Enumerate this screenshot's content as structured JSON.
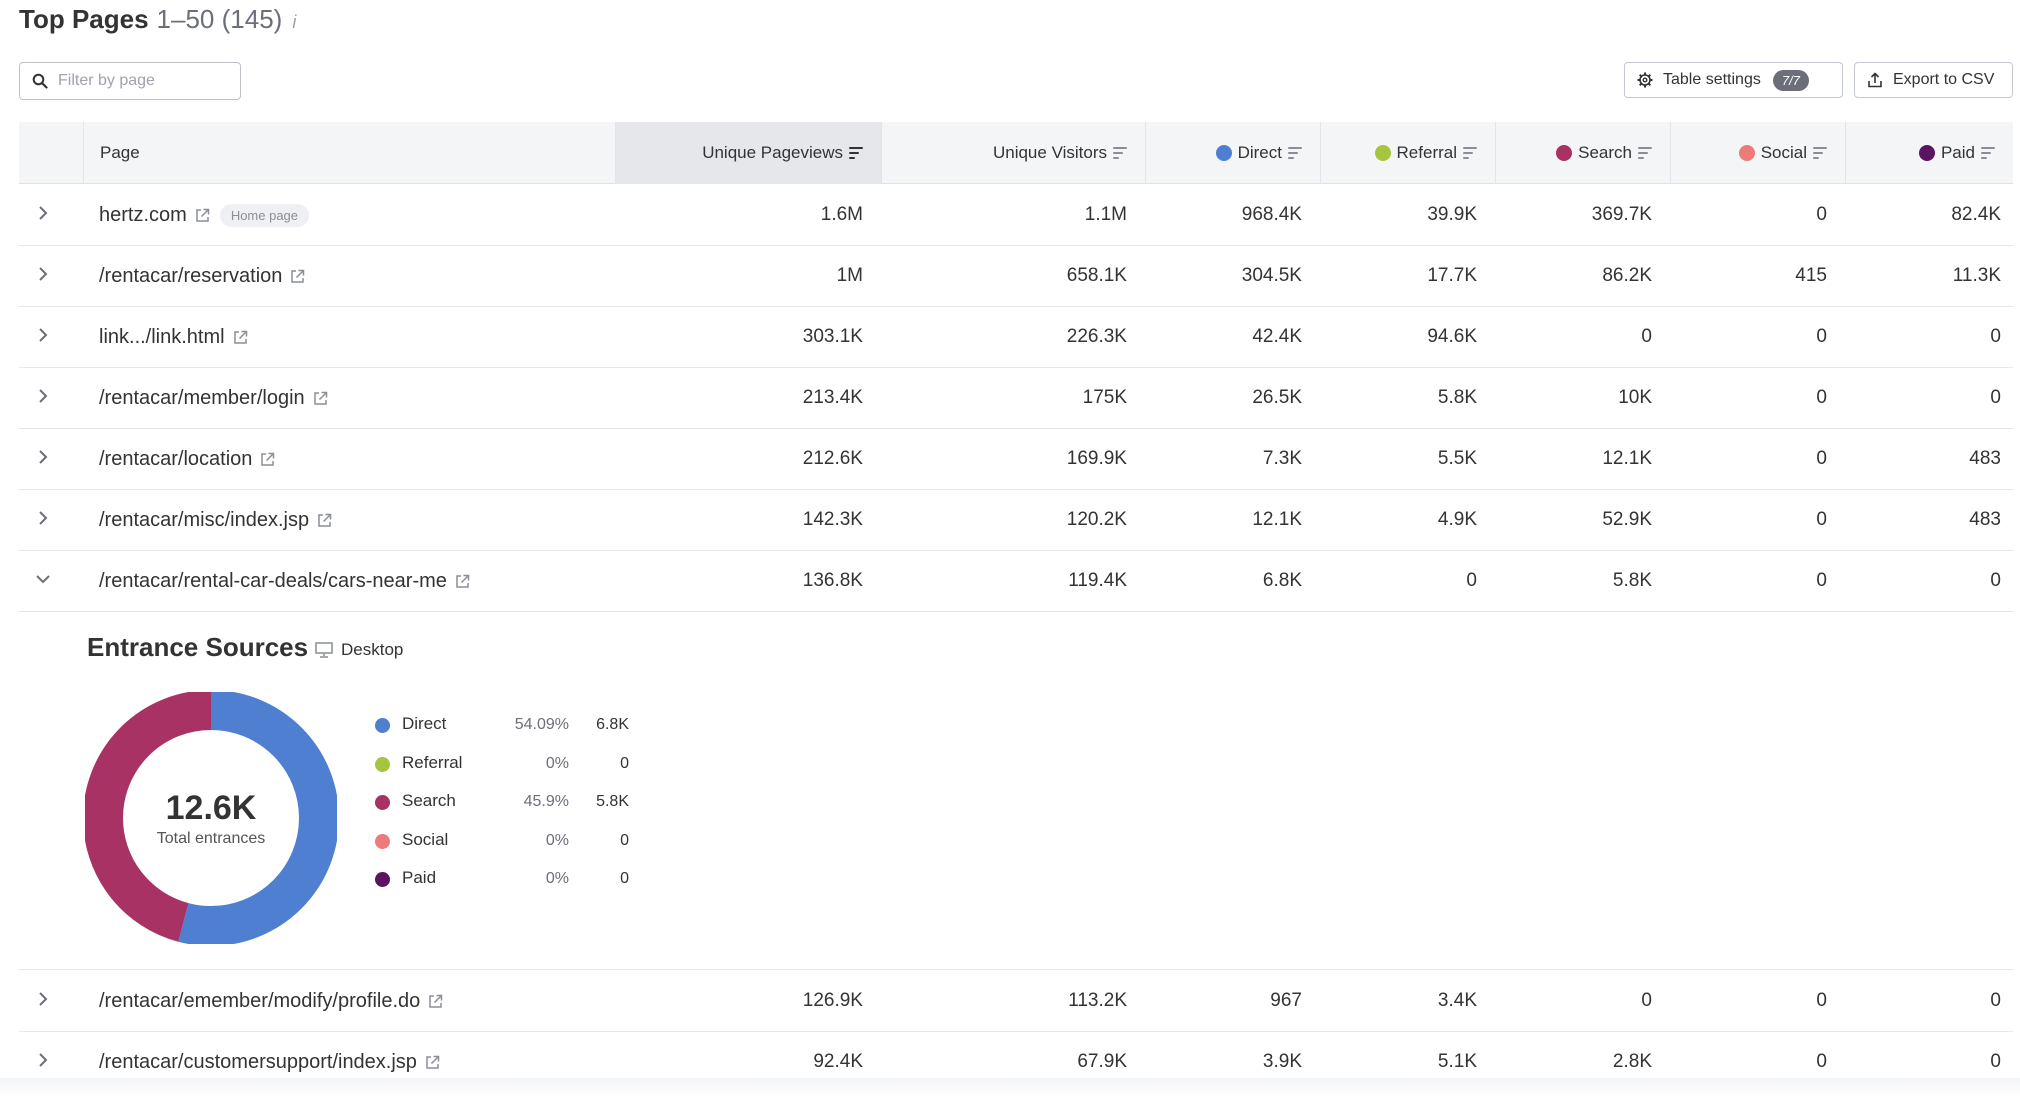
{
  "header": {
    "title": "Top Pages",
    "range": "1–50 (145)",
    "info": "i"
  },
  "filter": {
    "placeholder": "Filter by page",
    "value": ""
  },
  "toolbar": {
    "settings_label": "Table settings",
    "settings_badge": "7/7",
    "export_label": "Export to CSV"
  },
  "columns": {
    "page": "Page",
    "pageviews": "Unique Pageviews",
    "visitors": "Unique Visitors",
    "direct": "Direct",
    "referral": "Referral",
    "search": "Search",
    "social": "Social",
    "paid": "Paid"
  },
  "colors": {
    "direct": "#4f7fd0",
    "referral": "#a6c53e",
    "search": "#a83264",
    "social": "#ee7a7a",
    "paid": "#5a1462"
  },
  "rows": [
    {
      "page": "hertz.com",
      "badge": "Home page",
      "pageviews": "1.6M",
      "visitors": "1.1M",
      "direct": "968.4K",
      "referral": "39.9K",
      "search": "369.7K",
      "social": "0",
      "paid": "82.4K"
    },
    {
      "page": "/rentacar/reservation",
      "pageviews": "1M",
      "visitors": "658.1K",
      "direct": "304.5K",
      "referral": "17.7K",
      "search": "86.2K",
      "social": "415",
      "paid": "11.3K"
    },
    {
      "page": "link.../link.html",
      "pageviews": "303.1K",
      "visitors": "226.3K",
      "direct": "42.4K",
      "referral": "94.6K",
      "search": "0",
      "social": "0",
      "paid": "0"
    },
    {
      "page": "/rentacar/member/login",
      "pageviews": "213.4K",
      "visitors": "175K",
      "direct": "26.5K",
      "referral": "5.8K",
      "search": "10K",
      "social": "0",
      "paid": "0"
    },
    {
      "page": "/rentacar/location",
      "pageviews": "212.6K",
      "visitors": "169.9K",
      "direct": "7.3K",
      "referral": "5.5K",
      "search": "12.1K",
      "social": "0",
      "paid": "483"
    },
    {
      "page": "/rentacar/misc/index.jsp",
      "pageviews": "142.3K",
      "visitors": "120.2K",
      "direct": "12.1K",
      "referral": "4.9K",
      "search": "52.9K",
      "social": "0",
      "paid": "483"
    },
    {
      "page": "/rentacar/rental-car-deals/cars-near-me",
      "pageviews": "136.8K",
      "visitors": "119.4K",
      "direct": "6.8K",
      "referral": "0",
      "search": "5.8K",
      "social": "0",
      "paid": "0"
    },
    {
      "page": "/rentacar/emember/modify/profile.do",
      "pageviews": "126.9K",
      "visitors": "113.2K",
      "direct": "967",
      "referral": "3.4K",
      "search": "0",
      "social": "0",
      "paid": "0"
    },
    {
      "page": "/rentacar/customersupport/index.jsp",
      "pageviews": "92.4K",
      "visitors": "67.9K",
      "direct": "3.9K",
      "referral": "5.1K",
      "search": "2.8K",
      "social": "0",
      "paid": "0"
    }
  ],
  "expanded": {
    "title": "Entrance Sources",
    "device": "Desktop",
    "total_value": "12.6K",
    "total_label": "Total entrances",
    "sources": [
      {
        "name": "Direct",
        "pct": "54.09%",
        "value": "6.8K",
        "share": 0.541
      },
      {
        "name": "Referral",
        "pct": "0%",
        "value": "0",
        "share": 0
      },
      {
        "name": "Search",
        "pct": "45.9%",
        "value": "5.8K",
        "share": 0.459
      },
      {
        "name": "Social",
        "pct": "0%",
        "value": "0",
        "share": 0
      },
      {
        "name": "Paid",
        "pct": "0%",
        "value": "0",
        "share": 0
      }
    ]
  }
}
